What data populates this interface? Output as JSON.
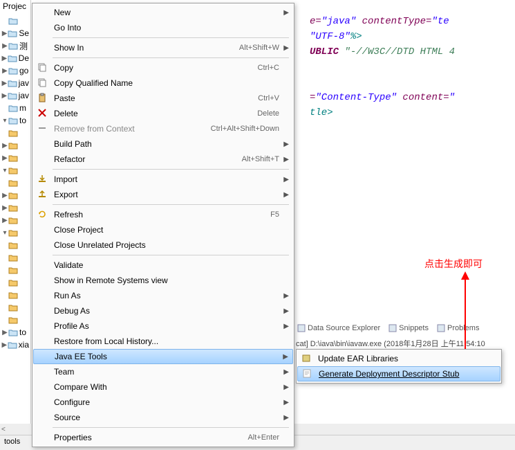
{
  "project_panel": {
    "title": "Projec",
    "items": [
      {
        "exp": "",
        "label": ""
      },
      {
        "exp": ">",
        "label": "Se"
      },
      {
        "exp": ">",
        "label": "测"
      },
      {
        "exp": ">",
        "label": "De"
      },
      {
        "exp": ">",
        "label": "go"
      },
      {
        "exp": ">",
        "label": "jav"
      },
      {
        "exp": ">",
        "label": "jav"
      },
      {
        "exp": "",
        "label": "m"
      },
      {
        "exp": "v",
        "label": "to"
      },
      {
        "exp": "",
        "label": ""
      },
      {
        "exp": ">",
        "label": ""
      },
      {
        "exp": ">",
        "label": ""
      },
      {
        "exp": "v",
        "label": ""
      },
      {
        "exp": "",
        "label": ""
      },
      {
        "exp": ">",
        "label": ""
      },
      {
        "exp": ">",
        "label": ""
      },
      {
        "exp": ">",
        "label": ""
      },
      {
        "exp": "v",
        "label": ""
      },
      {
        "exp": "",
        "label": ""
      },
      {
        "exp": "",
        "label": ""
      },
      {
        "exp": "",
        "label": ""
      },
      {
        "exp": "",
        "label": ""
      },
      {
        "exp": "",
        "label": ""
      },
      {
        "exp": "",
        "label": ""
      },
      {
        "exp": "",
        "label": ""
      },
      {
        "exp": ">",
        "label": "to"
      },
      {
        "exp": ">",
        "label": "xia"
      }
    ]
  },
  "editor": {
    "lines": [
      {
        "parts": [
          {
            "t": "e=",
            "c": "attr"
          },
          {
            "t": "\"java\"",
            "c": "str"
          },
          {
            "t": " contentType=",
            "c": "attr"
          },
          {
            "t": "\"te",
            "c": "str"
          }
        ]
      },
      {
        "parts": [
          {
            "t": "\"UTF-8\"",
            "c": "str"
          },
          {
            "t": "%>",
            "c": "tagend"
          }
        ]
      },
      {
        "parts": [
          {
            "t": "UBLIC ",
            "c": "kw"
          },
          {
            "t": "\"-//W3C//DTD HTML 4",
            "c": "green"
          }
        ]
      },
      {
        "parts": []
      },
      {
        "parts": []
      },
      {
        "parts": [
          {
            "t": "=",
            "c": "attr"
          },
          {
            "t": "\"Content-Type\"",
            "c": "str"
          },
          {
            "t": " content=",
            "c": "attr"
          },
          {
            "t": "\"",
            "c": "str"
          }
        ]
      },
      {
        "parts": [
          {
            "t": "tle>",
            "c": "tagend"
          }
        ]
      }
    ]
  },
  "context_menu": [
    {
      "type": "item",
      "label": "New",
      "arrow": true,
      "icon": ""
    },
    {
      "type": "item",
      "label": "Go Into"
    },
    {
      "type": "sep"
    },
    {
      "type": "item",
      "label": "Show In",
      "accel": "Alt+Shift+W",
      "arrow": true
    },
    {
      "type": "sep"
    },
    {
      "type": "item",
      "label": "Copy",
      "accel": "Ctrl+C",
      "icon": "copy"
    },
    {
      "type": "item",
      "label": "Copy Qualified Name",
      "icon": "copy"
    },
    {
      "type": "item",
      "label": "Paste",
      "accel": "Ctrl+V",
      "icon": "paste"
    },
    {
      "type": "item",
      "label": "Delete",
      "accel": "Delete",
      "icon": "delete"
    },
    {
      "type": "item",
      "label": "Remove from Context",
      "accel": "Ctrl+Alt+Shift+Down",
      "disabled": true,
      "icon": "remove"
    },
    {
      "type": "item",
      "label": "Build Path",
      "arrow": true
    },
    {
      "type": "item",
      "label": "Refactor",
      "accel": "Alt+Shift+T",
      "arrow": true
    },
    {
      "type": "sep"
    },
    {
      "type": "item",
      "label": "Import",
      "arrow": true,
      "icon": "import"
    },
    {
      "type": "item",
      "label": "Export",
      "arrow": true,
      "icon": "export"
    },
    {
      "type": "sep"
    },
    {
      "type": "item",
      "label": "Refresh",
      "accel": "F5",
      "icon": "refresh"
    },
    {
      "type": "item",
      "label": "Close Project"
    },
    {
      "type": "item",
      "label": "Close Unrelated Projects"
    },
    {
      "type": "sep"
    },
    {
      "type": "item",
      "label": "Validate"
    },
    {
      "type": "item",
      "label": "Show in Remote Systems view"
    },
    {
      "type": "item",
      "label": "Run As",
      "arrow": true
    },
    {
      "type": "item",
      "label": "Debug As",
      "arrow": true
    },
    {
      "type": "item",
      "label": "Profile As",
      "arrow": true
    },
    {
      "type": "item",
      "label": "Restore from Local History..."
    },
    {
      "type": "item",
      "label": "Java EE Tools",
      "arrow": true,
      "highlight": true
    },
    {
      "type": "item",
      "label": "Team",
      "arrow": true
    },
    {
      "type": "item",
      "label": "Compare With",
      "arrow": true
    },
    {
      "type": "item",
      "label": "Configure",
      "arrow": true
    },
    {
      "type": "item",
      "label": "Source",
      "arrow": true
    },
    {
      "type": "sep"
    },
    {
      "type": "item",
      "label": "Properties",
      "accel": "Alt+Enter"
    }
  ],
  "submenu": [
    {
      "label": "Update EAR Libraries",
      "icon": "ear"
    },
    {
      "label": "Generate Deployment Descriptor Stub",
      "highlight": true,
      "icon": "gen"
    }
  ],
  "bottom_tabs": [
    "Data Source Explorer",
    "Snippets",
    "Problems"
  ],
  "console_line": "cat] D:\\iava\\bin\\iavaw.exe (2018年1月28日  上午11:54:10",
  "annotation": "点击生成即可",
  "status": "tools",
  "scroll_badge": "<"
}
